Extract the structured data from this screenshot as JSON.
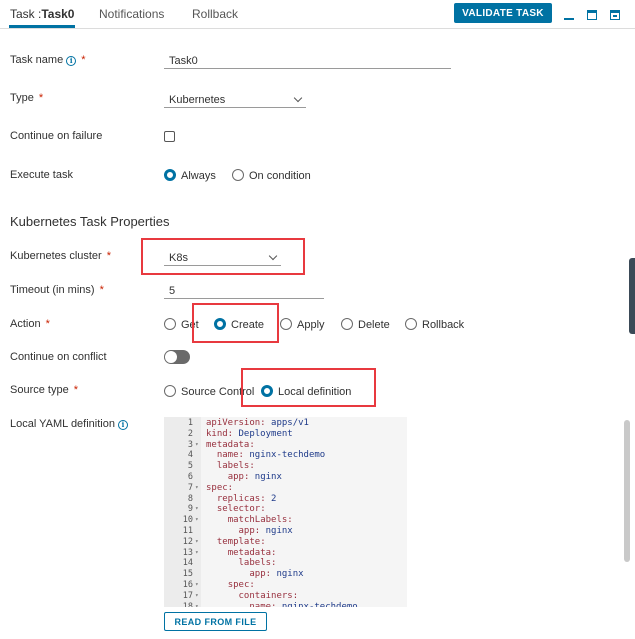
{
  "tabs": {
    "task": {
      "prefix": "Task :",
      "name": "Task0"
    },
    "notifications": "Notifications",
    "rollback": "Rollback"
  },
  "toolbar": {
    "validate_label": "VALIDATE TASK"
  },
  "form": {
    "task_name": {
      "label": "Task name",
      "value": "Task0"
    },
    "type": {
      "label": "Type",
      "value": "Kubernetes"
    },
    "continue_on_failure": {
      "label": "Continue on failure",
      "checked": false
    },
    "execute_task": {
      "label": "Execute task",
      "options": [
        "Always",
        "On condition"
      ],
      "selected": "Always"
    }
  },
  "k8s": {
    "section_title": "Kubernetes Task Properties",
    "cluster": {
      "label": "Kubernetes cluster",
      "value": "K8s"
    },
    "timeout": {
      "label": "Timeout (in mins)",
      "value": "5"
    },
    "action": {
      "label": "Action",
      "options": [
        "Get",
        "Create",
        "Apply",
        "Delete",
        "Rollback"
      ],
      "selected": "Create"
    },
    "continue_on_conflict": {
      "label": "Continue on conflict",
      "enabled": false
    },
    "source_type": {
      "label": "Source type",
      "options": [
        "Source Control",
        "Local definition"
      ],
      "selected": "Local definition"
    },
    "yaml": {
      "label": "Local YAML definition",
      "lines": [
        {
          "n": "1",
          "text": "apiVersion: apps/v1"
        },
        {
          "n": "2",
          "text": "kind: Deployment"
        },
        {
          "n": "3",
          "text": "metadata:"
        },
        {
          "n": "4",
          "text": "  name: nginx-techdemo"
        },
        {
          "n": "5",
          "text": "  labels:"
        },
        {
          "n": "6",
          "text": "    app: nginx"
        },
        {
          "n": "7",
          "text": "spec:"
        },
        {
          "n": "8",
          "text": "  replicas: 2"
        },
        {
          "n": "9",
          "text": "  selector:"
        },
        {
          "n": "10",
          "text": "    matchLabels:"
        },
        {
          "n": "11",
          "text": "      app: nginx"
        },
        {
          "n": "12",
          "text": "  template:"
        },
        {
          "n": "13",
          "text": "    metadata:"
        },
        {
          "n": "14",
          "text": "      labels:"
        },
        {
          "n": "15",
          "text": "        app: nginx"
        },
        {
          "n": "16",
          "text": "    spec:"
        },
        {
          "n": "17",
          "text": "      containers:"
        },
        {
          "n": "18",
          "text": "        name: nginx-techdemo"
        }
      ]
    },
    "read_from_file_label": "READ FROM FILE"
  },
  "colors": {
    "accent": "#0072a3",
    "highlight": "#e8393f",
    "required": "#c92100"
  }
}
